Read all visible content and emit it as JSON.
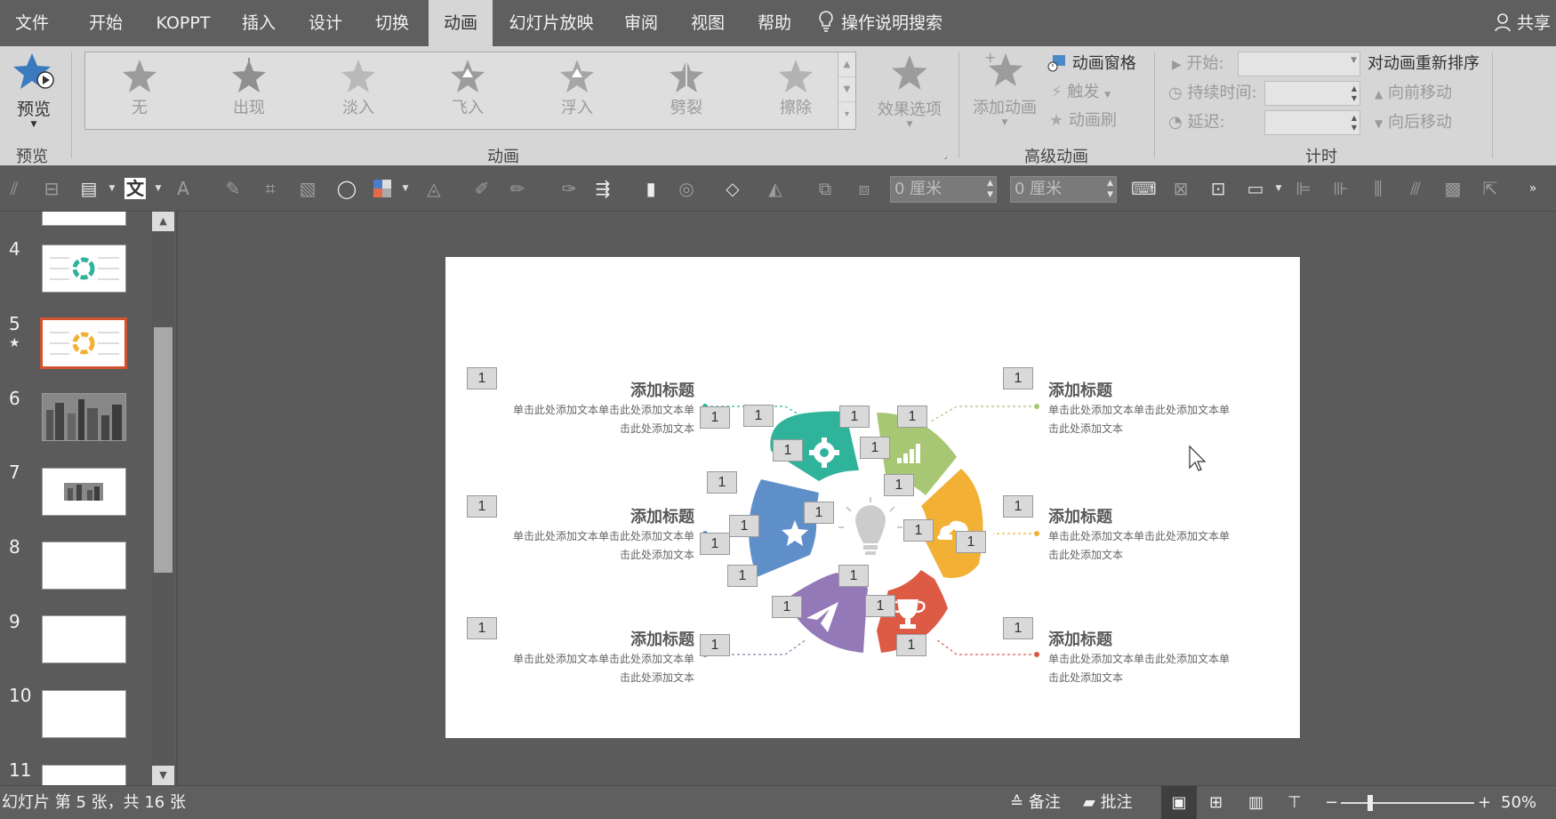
{
  "menu": {
    "tabs": [
      "文件",
      "开始",
      "KOPPT",
      "插入",
      "设计",
      "切换",
      "动画",
      "幻灯片放映",
      "审阅",
      "视图",
      "帮助"
    ],
    "active_index": 6,
    "search_label": "操作说明搜索",
    "share_label": "共享"
  },
  "ribbon": {
    "preview": {
      "label": "预览",
      "group": "预览"
    },
    "animations": {
      "group": "动画",
      "items": [
        "无",
        "出现",
        "淡入",
        "飞入",
        "浮入",
        "劈裂",
        "擦除"
      ],
      "effect_options": "效果选项"
    },
    "advanced": {
      "group": "高级动画",
      "add_animation": "添加动画",
      "animation_pane": "动画窗格",
      "trigger": "触发",
      "painter": "动画刷"
    },
    "timing": {
      "group": "计时",
      "start_label": "开始:",
      "duration_label": "持续时间:",
      "delay_label": "延迟:",
      "reorder_label": "对动画重新排序",
      "move_earlier": "向前移动",
      "move_later": "向后移动"
    }
  },
  "toolbar2": {
    "width_value": "0 厘米",
    "height_value": "0 厘米"
  },
  "thumbs": {
    "items": [
      {
        "num": "4",
        "type": "circle"
      },
      {
        "num": "5",
        "type": "circle",
        "selected": true,
        "has_anim": true
      },
      {
        "num": "6",
        "type": "city"
      },
      {
        "num": "7",
        "type": "small-city"
      },
      {
        "num": "8",
        "type": "blank"
      },
      {
        "num": "9",
        "type": "blank"
      },
      {
        "num": "10",
        "type": "blank"
      },
      {
        "num": "11",
        "type": "blank"
      }
    ],
    "anim_star": "★"
  },
  "slide": {
    "blocks": [
      {
        "title": "添加标题",
        "body": "单击此处添加文本单击此处添加文本单击此处添加文本",
        "side": "left"
      },
      {
        "title": "添加标题",
        "body": "单击此处添加文本单击此处添加文本单击此处添加文本",
        "side": "left"
      },
      {
        "title": "添加标题",
        "body": "单击此处添加文本单击此处添加文本单击此处添加文本",
        "side": "left"
      },
      {
        "title": "添加标题",
        "body": "单击此处添加文本单击此处添加文本单击此处添加文本",
        "side": "right"
      },
      {
        "title": "添加标题",
        "body": "单击此处添加文本单击此处添加文本单击此处添加文本",
        "side": "right"
      },
      {
        "title": "添加标题",
        "body": "单击此处添加文本单击此处添加文本单击此处添加文本",
        "side": "right"
      }
    ],
    "anim_tag_label": "1",
    "petal_colors": {
      "teal": "#2fb39a",
      "green": "#a7c774",
      "orange": "#f2b134",
      "red": "#dd5a45",
      "purple": "#9479b8",
      "blue": "#5f8fc9",
      "bulb": "#cccccc"
    }
  },
  "status": {
    "slide_info": "幻灯片 第 5 张，共 16 张",
    "notes": "备注",
    "comments": "批注",
    "zoom": "50%"
  }
}
